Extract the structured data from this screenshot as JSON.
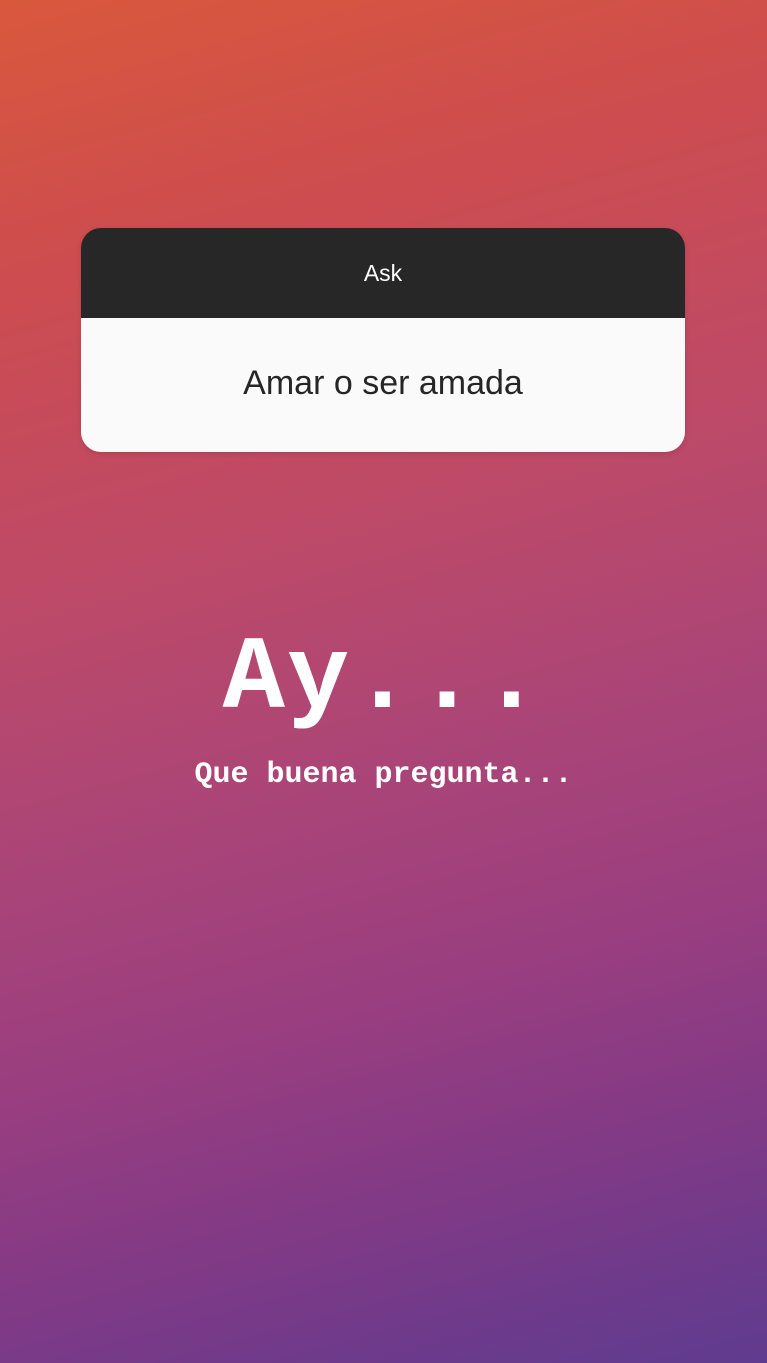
{
  "question_sticker": {
    "header": "Ask",
    "question": "Amar o ser amada"
  },
  "reply": {
    "title": "Ay...",
    "subtitle": "Que buena pregunta..."
  },
  "colors": {
    "gradient_top": "#d9583c",
    "gradient_middle": "#be4a67",
    "gradient_bottom": "#5f3b8f",
    "sticker_header_bg": "#272727",
    "sticker_body_bg": "#fafafa",
    "text_white": "#ffffff"
  }
}
